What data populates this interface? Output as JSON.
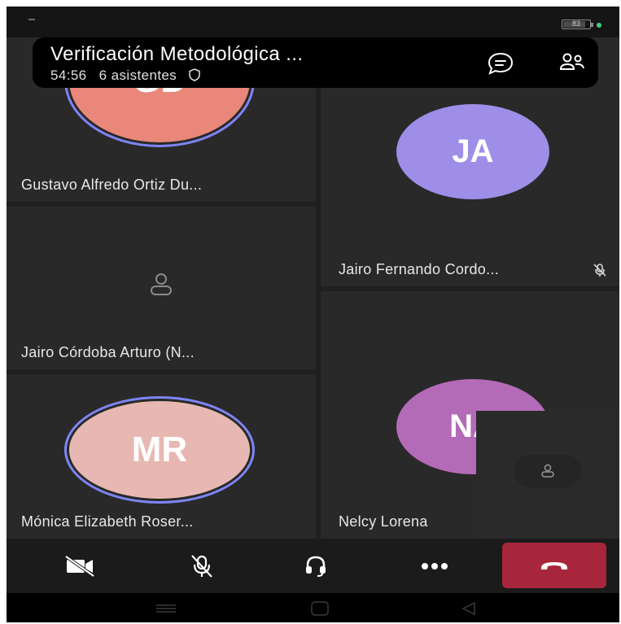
{
  "header": {
    "title": "Verificación Metodológica ...",
    "duration": "54:56",
    "attendees": "6 asistentes"
  },
  "status_bar": {
    "battery": "83"
  },
  "tiles": [
    {
      "initials": "GD",
      "name": "Gustavo Alfredo Ortiz Du...",
      "avatar_color": "#e8877a"
    },
    {
      "initials": "JA",
      "name": "Jairo Fernando Cordo...",
      "avatar_color": "#9e8ee8",
      "muted": true
    },
    {
      "initials": "",
      "name": "Jairo Córdoba Arturo (N...",
      "avatar_color": ""
    },
    {
      "initials": "NA",
      "name": "Nelcy Lorena",
      "avatar_color": "#b46bb7"
    },
    {
      "initials": "MR",
      "name": "Mónica Elizabeth Roser...",
      "avatar_color": "#e7b8b1"
    }
  ],
  "colors": {
    "speaking_ring": "#7f85f5",
    "hangup": "#a8263b",
    "background": "#1f1f1f"
  },
  "icons": {
    "chat": "chat-icon",
    "participants": "participants-icon",
    "shield": "shield-icon",
    "camera_off": "camera-off-icon",
    "mic_off": "mic-off-icon",
    "audio": "headset-icon",
    "more": "more-icon",
    "hangup": "hangup-icon"
  }
}
